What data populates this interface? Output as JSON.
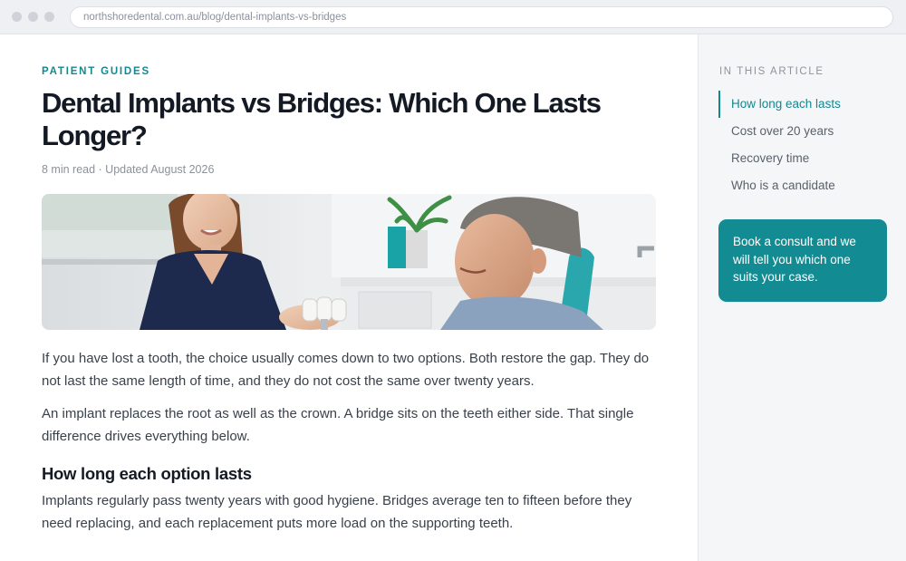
{
  "browser": {
    "url": "northshoredental.com.au/blog/dental-implants-vs-bridges"
  },
  "article": {
    "eyebrow": "PATIENT GUIDES",
    "title": "Dental Implants vs Bridges: Which One Lasts Longer?",
    "meta": "8 min read · Updated August 2026",
    "paragraphs": [
      "If you have lost a tooth, the choice usually comes down to two options. Both restore the gap. They do not last the same length of time, and they do not cost the same over twenty years.",
      "An implant replaces the root as well as the crown. A bridge sits on the teeth either side. That single difference drives everything below."
    ],
    "section_heading": "How long each option lasts",
    "section_paragraph": "Implants regularly pass twenty years with good hygiene. Bridges average ten to fifteen before they need replacing, and each replacement puts more load on the supporting teeth."
  },
  "sidebar": {
    "toc_title": "IN THIS ARTICLE",
    "items": [
      {
        "label": "How long each lasts",
        "active": true
      },
      {
        "label": "Cost over 20 years",
        "active": false
      },
      {
        "label": "Recovery time",
        "active": false
      },
      {
        "label": "Who is a candidate",
        "active": false
      }
    ],
    "cta": "Book a consult and we will tell you which one suits your case."
  },
  "colors": {
    "accent": "#13888f",
    "cta_bg": "#138b93",
    "heading": "#141a24",
    "sidebar_bg": "#f5f6f8"
  }
}
